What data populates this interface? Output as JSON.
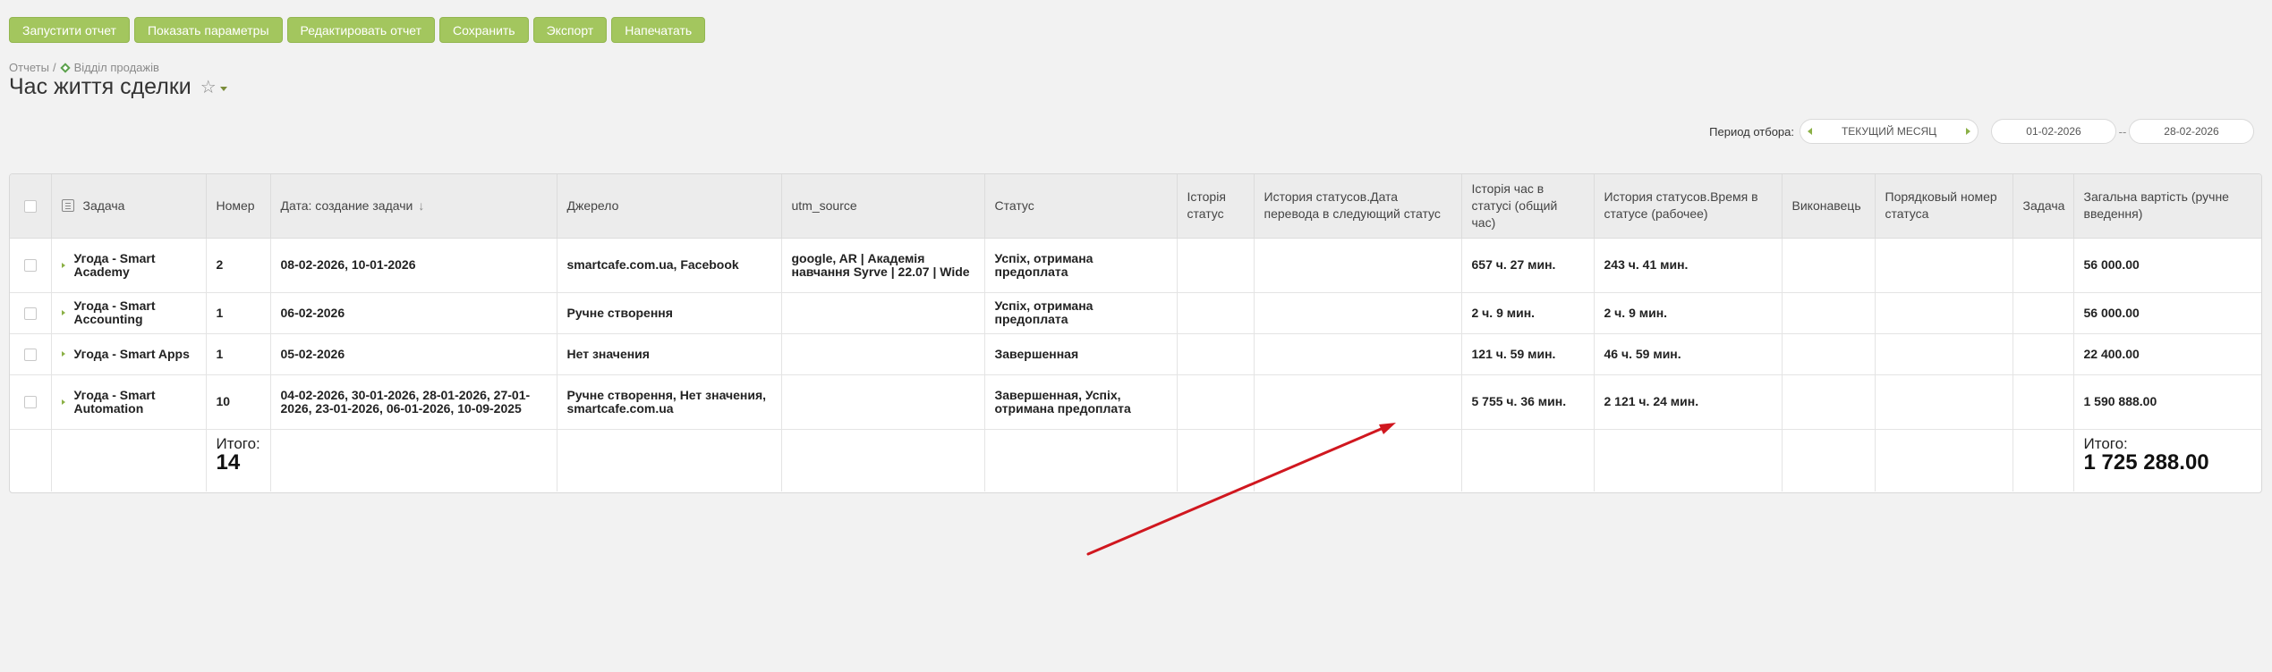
{
  "toolbar": {
    "run": "Запустити отчет",
    "params": "Показать параметры",
    "edit": "Редактировать отчет",
    "save": "Сохранить",
    "export": "Экспорт",
    "print": "Напечатать"
  },
  "breadcrumb": {
    "root": "Отчеты",
    "sep": "/",
    "section": "Відділ продажів"
  },
  "page": {
    "title": "Час життя сделки"
  },
  "period": {
    "label": "Период отбора:",
    "month": "ТЕКУЩИЙ МЕСЯЦ",
    "from": "01-02-2026",
    "sep": "--",
    "to": "28-02-2026"
  },
  "columns": [
    "Задача",
    "Номер",
    "Дата: создание задачи",
    "Джерело",
    "utm_source",
    "Статус",
    "Історія статус",
    "История статусов.Дата перевода в следующий статус",
    "Історія час в статусі (общий час)",
    "История статусов.Время в статусе (рабочее)",
    "Виконавець",
    "Порядковый номер статуса",
    "Задача",
    "Загальна вартість (ручне введення)"
  ],
  "rows": [
    {
      "task": "Угода - Smart Academy",
      "num": "2",
      "date": "08-02-2026, 10-01-2026",
      "source": "smartcafe.com.ua, Facebook",
      "utm": "google, AR | Академія навчання Syrve | 22.07 | Wide",
      "status": "Успіх, отримана предоплата",
      "hist": "",
      "hist_date": "",
      "time_total": "657 ч. 27 мин.",
      "time_work": "243 ч. 41 мин.",
      "exec": "",
      "order": "",
      "task2": "",
      "total": "56 000.00"
    },
    {
      "task": "Угода - Smart Accounting",
      "num": "1",
      "date": "06-02-2026",
      "source": "Ручне створення",
      "utm": "",
      "status": "Успіх, отримана предоплата",
      "hist": "",
      "hist_date": "",
      "time_total": "2 ч. 9 мин.",
      "time_work": "2 ч. 9 мин.",
      "exec": "",
      "order": "",
      "task2": "",
      "total": "56 000.00"
    },
    {
      "task": "Угода - Smart Apps",
      "num": "1",
      "date": "05-02-2026",
      "source": "Нет значения",
      "utm": "",
      "status": "Завершенная",
      "hist": "",
      "hist_date": "",
      "time_total": "121 ч. 59 мин.",
      "time_work": "46 ч. 59 мин.",
      "exec": "",
      "order": "",
      "task2": "",
      "total": "22 400.00"
    },
    {
      "task": "Угода - Smart Automation",
      "num": "10",
      "date": "04-02-2026, 30-01-2026, 28-01-2026, 27-01-2026, 23-01-2026, 06-01-2026, 10-09-2025",
      "source": "Ручне створення, Нет значения, smartcafe.com.ua",
      "utm": "",
      "status": "Завершенная, Успіх, отримана предоплата",
      "hist": "",
      "hist_date": "",
      "time_total": "5 755 ч. 36 мин.",
      "time_work": "2 121 ч. 24 мин.",
      "exec": "",
      "order": "",
      "task2": "",
      "total": "1 590 888.00"
    }
  ],
  "totals": {
    "label": "Итого:",
    "count": "14",
    "sum": "1 725 288.00"
  },
  "colors": {
    "button": "#a3c65e",
    "accent": "#8bb046",
    "annotation": "#d0171f"
  },
  "icons": {
    "sort": "arrow-down-icon",
    "favorite": "star-icon",
    "section": "diamond-icon"
  }
}
